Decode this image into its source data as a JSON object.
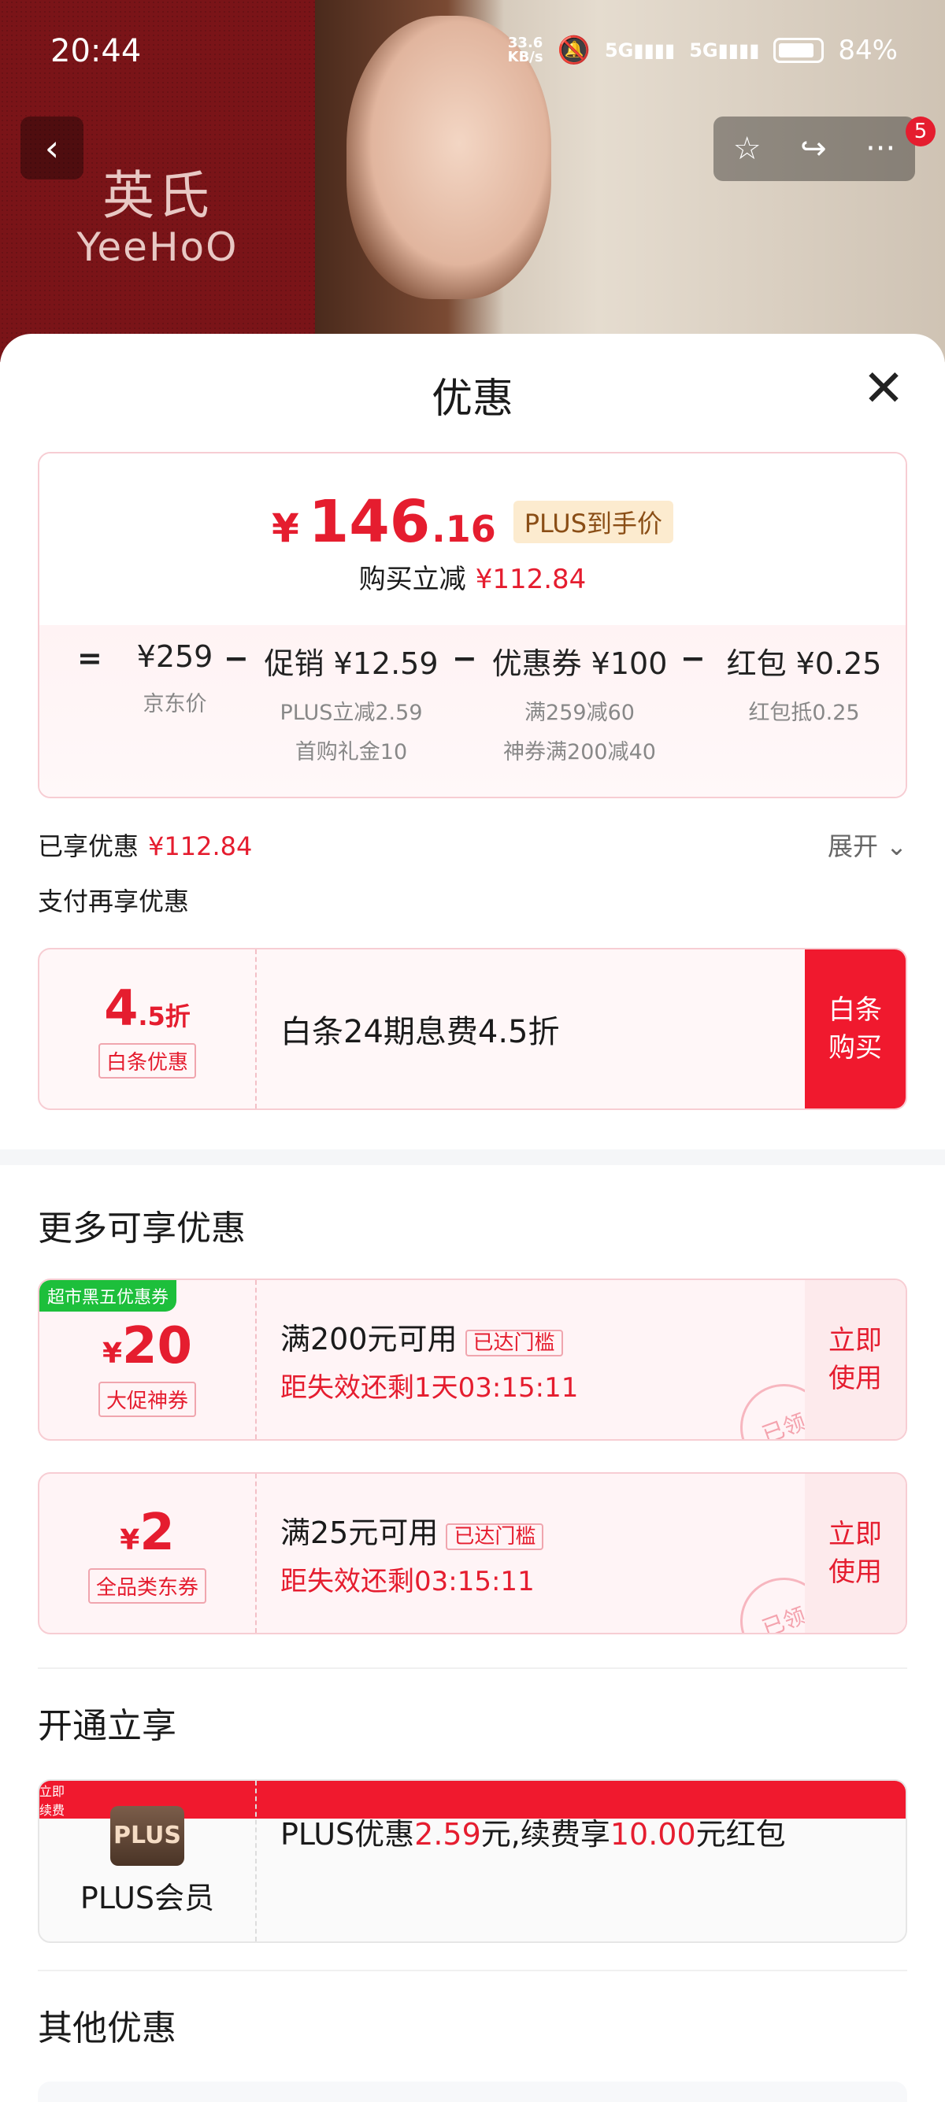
{
  "status": {
    "time": "20:44",
    "net_speed_top": "33.6",
    "net_speed_bottom": "KB/s",
    "sig1": "5G",
    "sig2": "5G",
    "battery": "84%"
  },
  "background": {
    "brand_cn": "英氏",
    "brand_en": "YeeHoO"
  },
  "nav": {
    "back_icon": "‹",
    "star_icon": "☆",
    "share_icon": "↪",
    "more_icon": "···",
    "notif_count": "5"
  },
  "sheet": {
    "title": "优惠",
    "close_icon": "✕"
  },
  "price": {
    "symbol": "¥",
    "int": "146",
    "dec": ".16",
    "plus_tag": "PLUS到手价",
    "instant_label": "购买立减",
    "instant_value": "¥112.84"
  },
  "formula": {
    "eq": "=",
    "minus": "−",
    "jd_price": "¥259",
    "jd_label": "京东价",
    "promo": "促销 ¥12.59",
    "promo_sub1": "PLUS立减2.59",
    "promo_sub2": "首购礼金10",
    "coupon": "优惠券 ¥100",
    "coupon_sub1": "满259减60",
    "coupon_sub2": "神券满200减40",
    "redpack": "红包 ¥0.25",
    "redpack_sub": "红包抵0.25"
  },
  "enjoyed": {
    "label": "已享优惠",
    "value": "¥112.84",
    "expand": "展开 ⌄",
    "pay_again": "支付再享优惠"
  },
  "baitiao": {
    "discount_big": "4",
    "discount_small": ".5折",
    "tag": "白条优惠",
    "desc": "白条24期息费4.5折",
    "cta": "白条\n购买"
  },
  "more": {
    "title": "更多可享优惠",
    "coupons": [
      {
        "badge": "超市黑五优惠券",
        "symbol": "¥",
        "amount": "20",
        "tag": "大促神券",
        "cond": "满200元可用",
        "reach": "已达门槛",
        "countdown": "距失效还剩1天03:15:11",
        "cta": "立即\n使用",
        "stamp": "已领"
      },
      {
        "symbol": "¥",
        "amount": "2",
        "tag": "全品类东券",
        "cond": "满25元可用",
        "reach": "已达门槛",
        "countdown": "距失效还剩03:15:11",
        "cta": "立即\n使用",
        "stamp": "已领"
      }
    ]
  },
  "plus_section": {
    "title": "开通立享",
    "logo": "PLUS",
    "name": "PLUS会员",
    "desc_a": "PLUS优惠",
    "desc_b": "2.59",
    "desc_c": "元,续费享",
    "desc_d": "10.00",
    "desc_e": "元红包",
    "cta": "立即\n续费"
  },
  "other": {
    "title": "其他优惠"
  },
  "colors": {
    "accent": "#e51d2f",
    "cta_red": "#f0192e",
    "badge_green": "#1dbf3b"
  }
}
